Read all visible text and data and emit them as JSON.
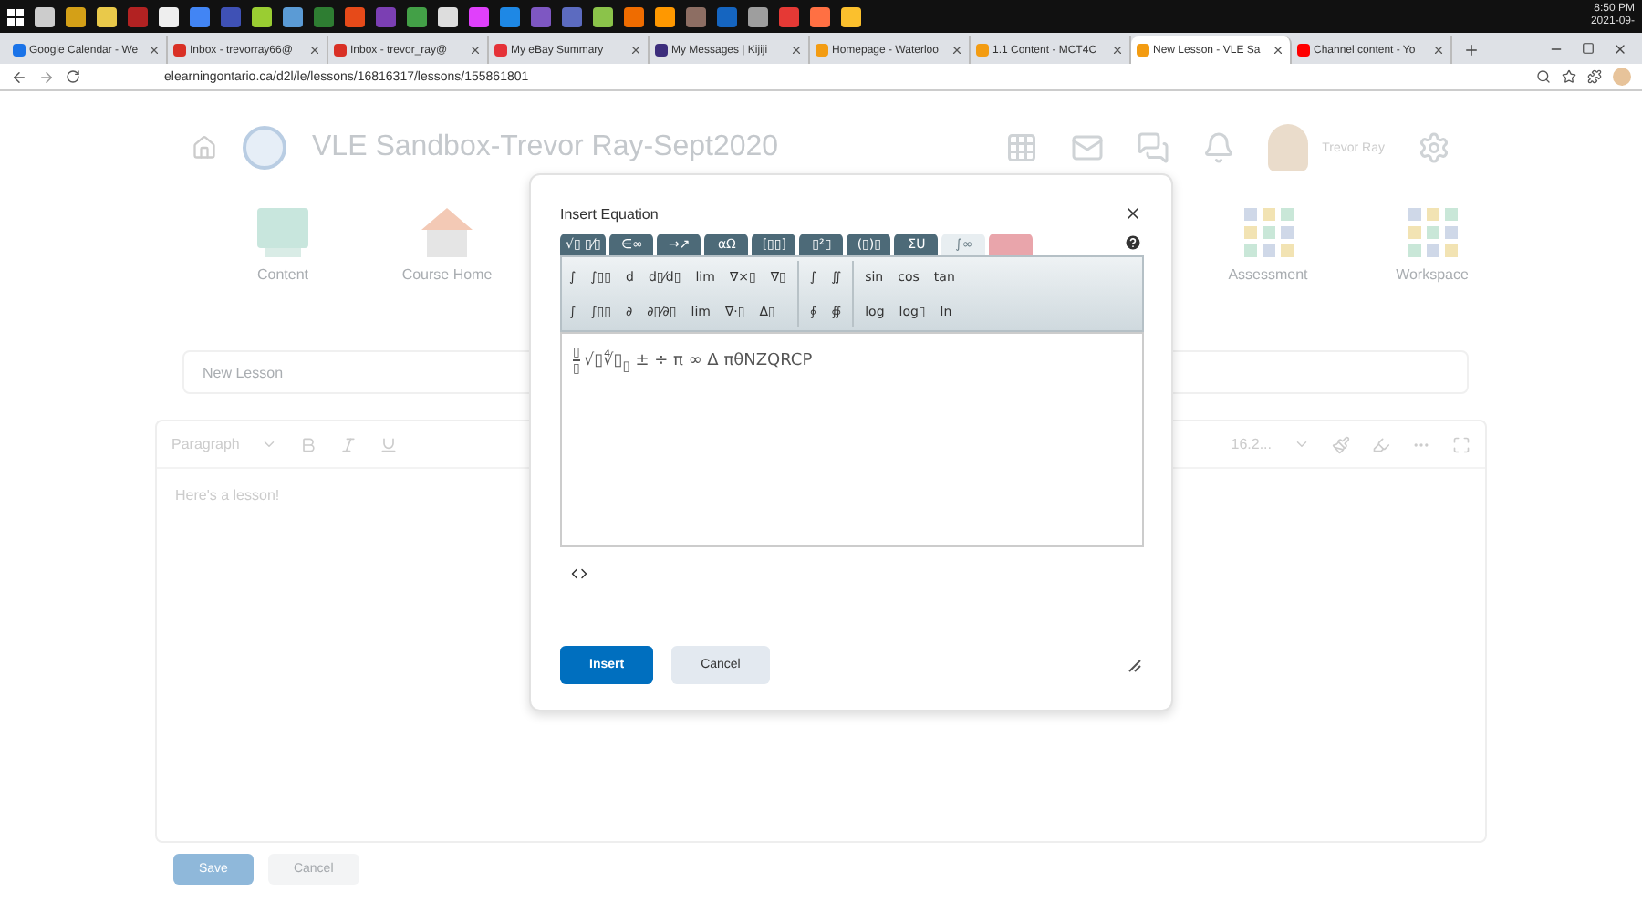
{
  "taskbar": {
    "clock": "8:50 PM",
    "date": "2021-09-"
  },
  "browser_tabs": [
    {
      "title": "Google Calendar - We",
      "selected": false
    },
    {
      "title": "Inbox - trevorray66@",
      "selected": false
    },
    {
      "title": "Inbox - trevor_ray@",
      "selected": false
    },
    {
      "title": "My eBay Summary",
      "selected": false
    },
    {
      "title": "My Messages | Kijiji",
      "selected": false
    },
    {
      "title": "Homepage - Waterloo",
      "selected": false
    },
    {
      "title": "1.1 Content - MCT4C",
      "selected": false
    },
    {
      "title": "New Lesson - VLE Sa",
      "selected": true
    },
    {
      "title": "Channel content - Yo",
      "selected": false
    }
  ],
  "address_bar": {
    "url": "elearningontario.ca/d2l/le/lessons/16816317/lessons/155861801"
  },
  "header": {
    "course_title": "VLE Sandbox-Trevor Ray-Sept2020",
    "user_name": "Trevor Ray"
  },
  "nav_tiles": {
    "left": [
      {
        "label": "Content",
        "kind": "book"
      },
      {
        "label": "Course Home",
        "kind": "house"
      }
    ],
    "right": [
      {
        "label": "Assessment",
        "kind": "grid"
      },
      {
        "label": "Workspace",
        "kind": "grid"
      }
    ]
  },
  "lesson_form": {
    "title_placeholder": "New Lesson",
    "block_format": "Paragraph",
    "font_size": "16.2...",
    "body": "Here's a lesson!",
    "buttons": [
      {
        "label": "Save",
        "kind": "primary"
      },
      {
        "label": "Cancel",
        "kind": "secondary"
      }
    ]
  },
  "dialog": {
    "title": "Insert Equation",
    "tabs": [
      {
        "label": "√▯ ▯⁄▯",
        "selected": false,
        "kind": "symbols"
      },
      {
        "label": "∈∞",
        "selected": false,
        "kind": "symbols"
      },
      {
        "label": "→↗",
        "selected": false,
        "kind": "symbols"
      },
      {
        "label": "αΩ",
        "selected": false,
        "kind": "symbols"
      },
      {
        "label": "[▯▯]",
        "selected": false,
        "kind": "symbols"
      },
      {
        "label": "▯²▯",
        "selected": false,
        "kind": "symbols"
      },
      {
        "label": "(▯)▯",
        "selected": false,
        "kind": "symbols"
      },
      {
        "label": "ΣU",
        "selected": false,
        "kind": "symbols"
      },
      {
        "label": "∫∞",
        "selected": true,
        "kind": "symbols"
      },
      {
        "selected": false,
        "kind": "accent"
      }
    ],
    "palette": [
      {
        "rows": [
          [
            "∫",
            "∫▯▯",
            "d",
            "d▯⁄d▯",
            "lim",
            "∇×▯",
            "∇▯"
          ],
          [
            "∫",
            "∫▯▯",
            "∂",
            "∂▯⁄∂▯",
            "lim",
            "∇·▯",
            "Δ▯"
          ]
        ]
      },
      {
        "rows": [
          [
            "∫",
            "∬"
          ],
          [
            "∮",
            "∯"
          ]
        ]
      },
      {
        "rows": [
          [
            "sin",
            "cos",
            "tan"
          ],
          [
            "log",
            "log▯",
            "ln"
          ]
        ]
      }
    ],
    "equation": {
      "numerator": "▯",
      "denominator": "▯",
      "rest": "√▯∜▯$_{▯}$ ± ÷ π ∞ Δ πθNZQRCP"
    },
    "buttons": [
      {
        "label": "Insert",
        "kind": "primary"
      },
      {
        "label": "Cancel",
        "kind": "secondary"
      }
    ]
  }
}
